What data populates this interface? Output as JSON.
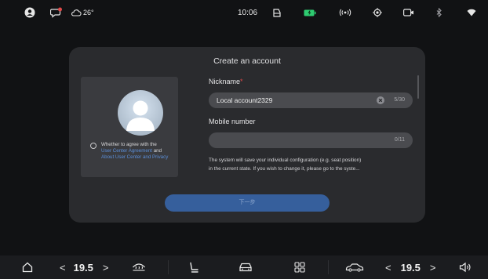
{
  "status_bar": {
    "weather_temp": "26°",
    "time": "10:06",
    "icons": [
      "user-icon",
      "message-badge-icon",
      "cloud-icon",
      "trunk-icon",
      "battery-icon",
      "hotspot-icon",
      "location-icon",
      "camera-icon",
      "bluetooth-icon",
      "wifi-icon"
    ]
  },
  "dialog": {
    "title": "Create an account",
    "agree": {
      "prefix": "Whether to agree with the",
      "link1": "User Center Agreement",
      "middle": " and",
      "link2": "About User Center and Privacy"
    },
    "nickname": {
      "label": "Nickname",
      "required_mark": "*",
      "value": "Local account2329",
      "counter": "5/30"
    },
    "mobile": {
      "label": "Mobile number",
      "value": "",
      "counter": "0/11"
    },
    "notice_line1": "The system will save your individual configuration (e.g. seat position)",
    "notice_line2": "in the current state. If you wish to change it, please go to the syste...",
    "next_label": "下一步"
  },
  "bottom_bar": {
    "left_temp": "19.5",
    "right_temp": "19.5",
    "dec_label": "<",
    "inc_label": ">",
    "icons": [
      "home-icon",
      "defrost-icon",
      "seat-icon",
      "car-icon",
      "apps-icon",
      "car-side-icon",
      "volume-icon"
    ]
  },
  "colors": {
    "accent": "#5b8ed9",
    "button": "#365f9c",
    "required": "#e24a4a",
    "dialog_bg": "#2a2b2e"
  }
}
